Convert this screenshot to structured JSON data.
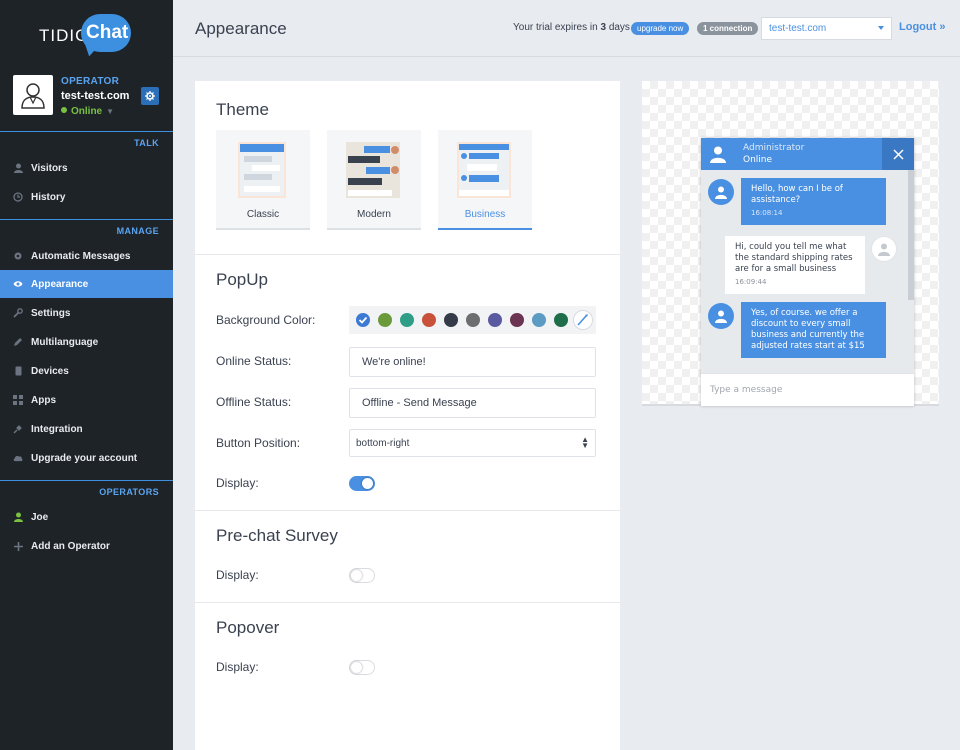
{
  "brand": {
    "name_prefix": "TIDIO",
    "name_suffix": "Chat"
  },
  "operator": {
    "role": "OPERATOR",
    "site": "test-test.com",
    "status": "Online"
  },
  "sidebar": {
    "talk_header": "TALK",
    "talk": [
      {
        "label": "Visitors",
        "icon": "user-icon"
      },
      {
        "label": "History",
        "icon": "clock-icon"
      }
    ],
    "manage_header": "MANAGE",
    "manage": [
      {
        "label": "Automatic Messages",
        "icon": "gear-icon"
      },
      {
        "label": "Appearance",
        "icon": "eye-icon",
        "active": true
      },
      {
        "label": "Settings",
        "icon": "wrench-icon"
      },
      {
        "label": "Multilanguage",
        "icon": "pencil-icon"
      },
      {
        "label": "Devices",
        "icon": "phone-icon"
      },
      {
        "label": "Apps",
        "icon": "grid-icon"
      },
      {
        "label": "Integration",
        "icon": "plug-icon"
      },
      {
        "label": "Upgrade your account",
        "icon": "cloud-icon"
      }
    ],
    "operators_header": "OPERATORS",
    "operators": [
      {
        "label": "Joe",
        "icon": "user-icon"
      },
      {
        "label": "Add an Operator",
        "icon": "plus-icon"
      }
    ]
  },
  "topbar": {
    "title": "Appearance",
    "trial_prefix": "Your trial expires in",
    "trial_days": "3",
    "trial_suffix": "days",
    "upgrade_label": "upgrade now",
    "connection_label": "1 connection",
    "site_value": "test-test.com",
    "logout_label": "Logout »"
  },
  "theme": {
    "title": "Theme",
    "options": [
      {
        "label": "Classic"
      },
      {
        "label": "Modern"
      },
      {
        "label": "Business",
        "selected": true
      }
    ]
  },
  "popup": {
    "title": "PopUp",
    "bg_color_label": "Background Color:",
    "colors": [
      "#3d7ad6",
      "#6a9a3c",
      "#2e9e87",
      "#c9513b",
      "#353b48",
      "#6e6e6e",
      "#5a5aa0",
      "#6b3453",
      "#5b9bc4",
      "#1f6e4b"
    ],
    "selected_color_index": 0,
    "online_status_label": "Online Status:",
    "online_status_value": "We're online!",
    "offline_status_label": "Offline Status:",
    "offline_status_value": "Offline - Send Message",
    "button_position_label": "Button Position:",
    "button_position_value": "bottom-right",
    "display_label": "Display:",
    "display_on": true
  },
  "prechat": {
    "title": "Pre-chat Survey",
    "display_label": "Display:",
    "display_on": false
  },
  "popover": {
    "title": "Popover",
    "display_label": "Display:",
    "display_on": false
  },
  "preview": {
    "header_name": "Administrator",
    "header_status": "Online",
    "input_placeholder": "Type a message",
    "messages": [
      {
        "from": "admin",
        "text": "Hello, how can I be of assistance?",
        "time": "16:08:14"
      },
      {
        "from": "user",
        "text": "Hi, could you tell me what the standard shipping rates are for a small business",
        "time": "16:09:44"
      },
      {
        "from": "admin",
        "text": "Yes, of course. we offer a discount to every small business and currently the adjusted rates start at $15",
        "time": ""
      }
    ]
  }
}
